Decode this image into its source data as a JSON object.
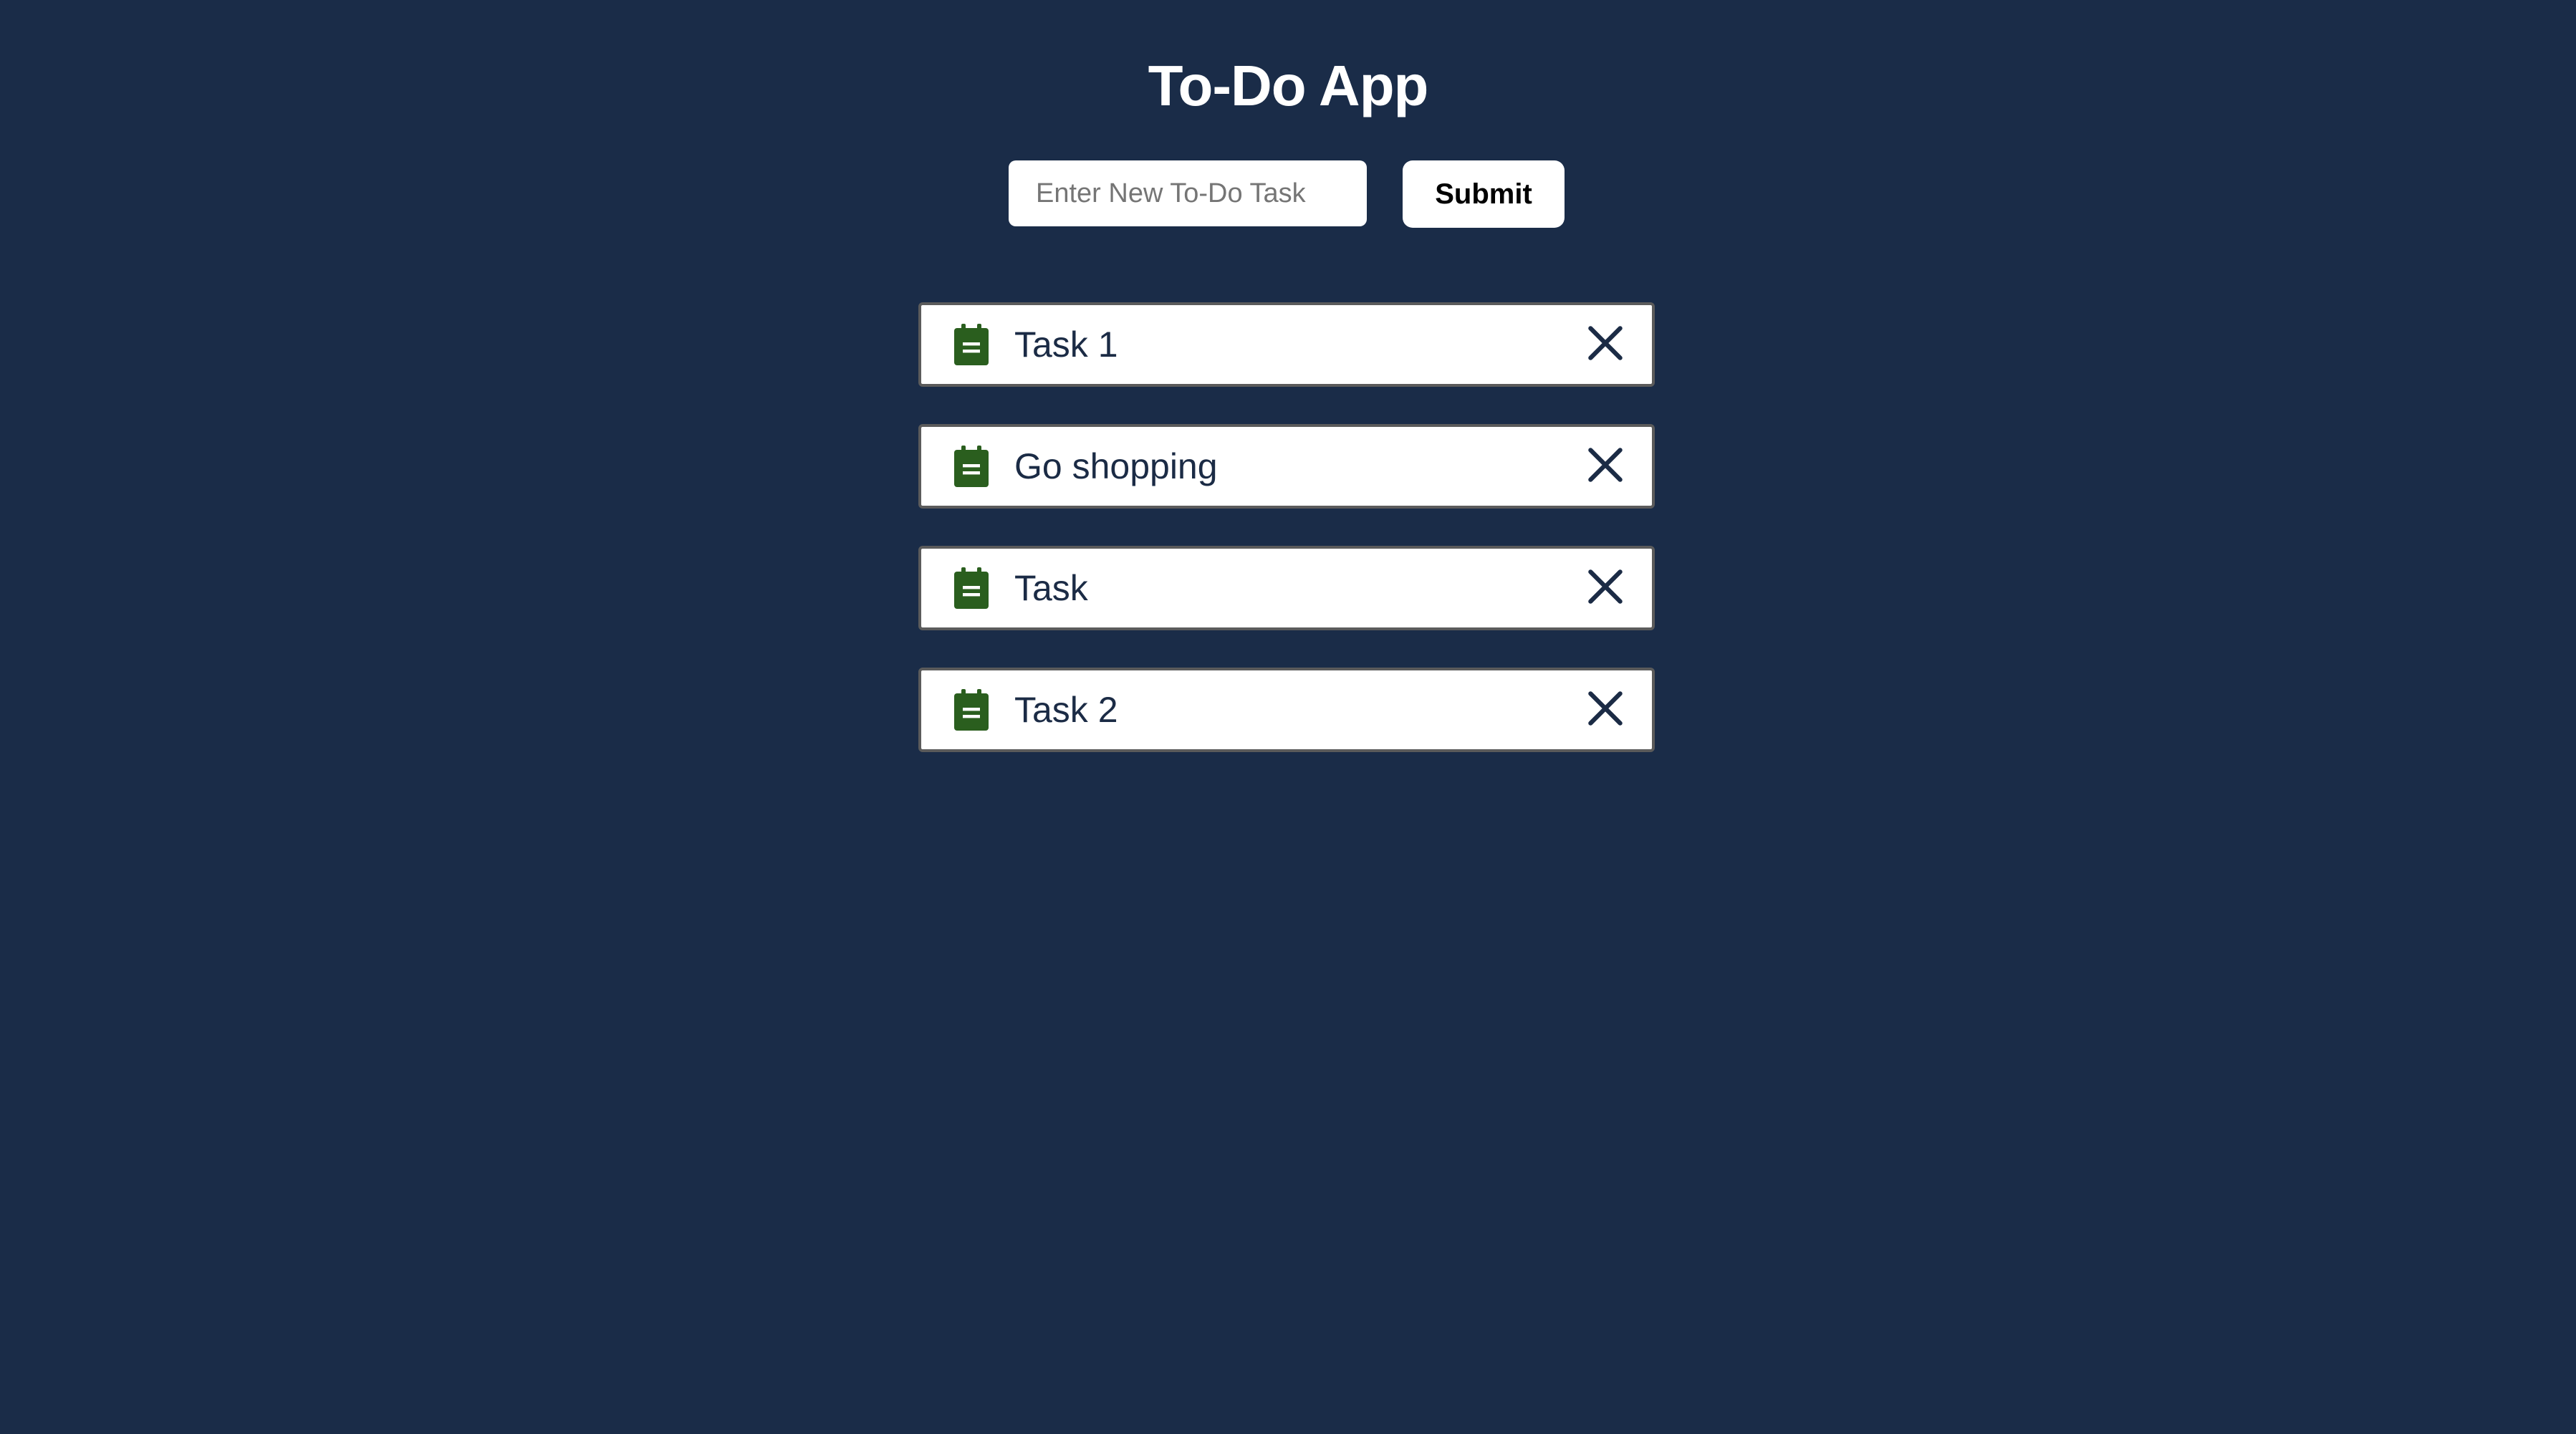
{
  "app": {
    "title": "To-Do App"
  },
  "form": {
    "input_value": "",
    "input_placeholder": "Enter New To-Do Task",
    "submit_label": "Submit"
  },
  "tasks": [
    {
      "text": "Task 1",
      "icon": "clipboard-icon",
      "action_icon": "close-icon"
    },
    {
      "text": "Go shopping",
      "icon": "clipboard-icon",
      "action_icon": "close-icon"
    },
    {
      "text": "Task",
      "icon": "clipboard-icon",
      "action_icon": "close-icon"
    },
    {
      "text": "Task 2",
      "icon": "clipboard-icon",
      "action_icon": "close-icon"
    }
  ],
  "colors": {
    "background": "#1a2c48",
    "task_icon": "#2a5e1e",
    "task_text": "#1b2b45",
    "delete_icon": "#1b2b45"
  }
}
